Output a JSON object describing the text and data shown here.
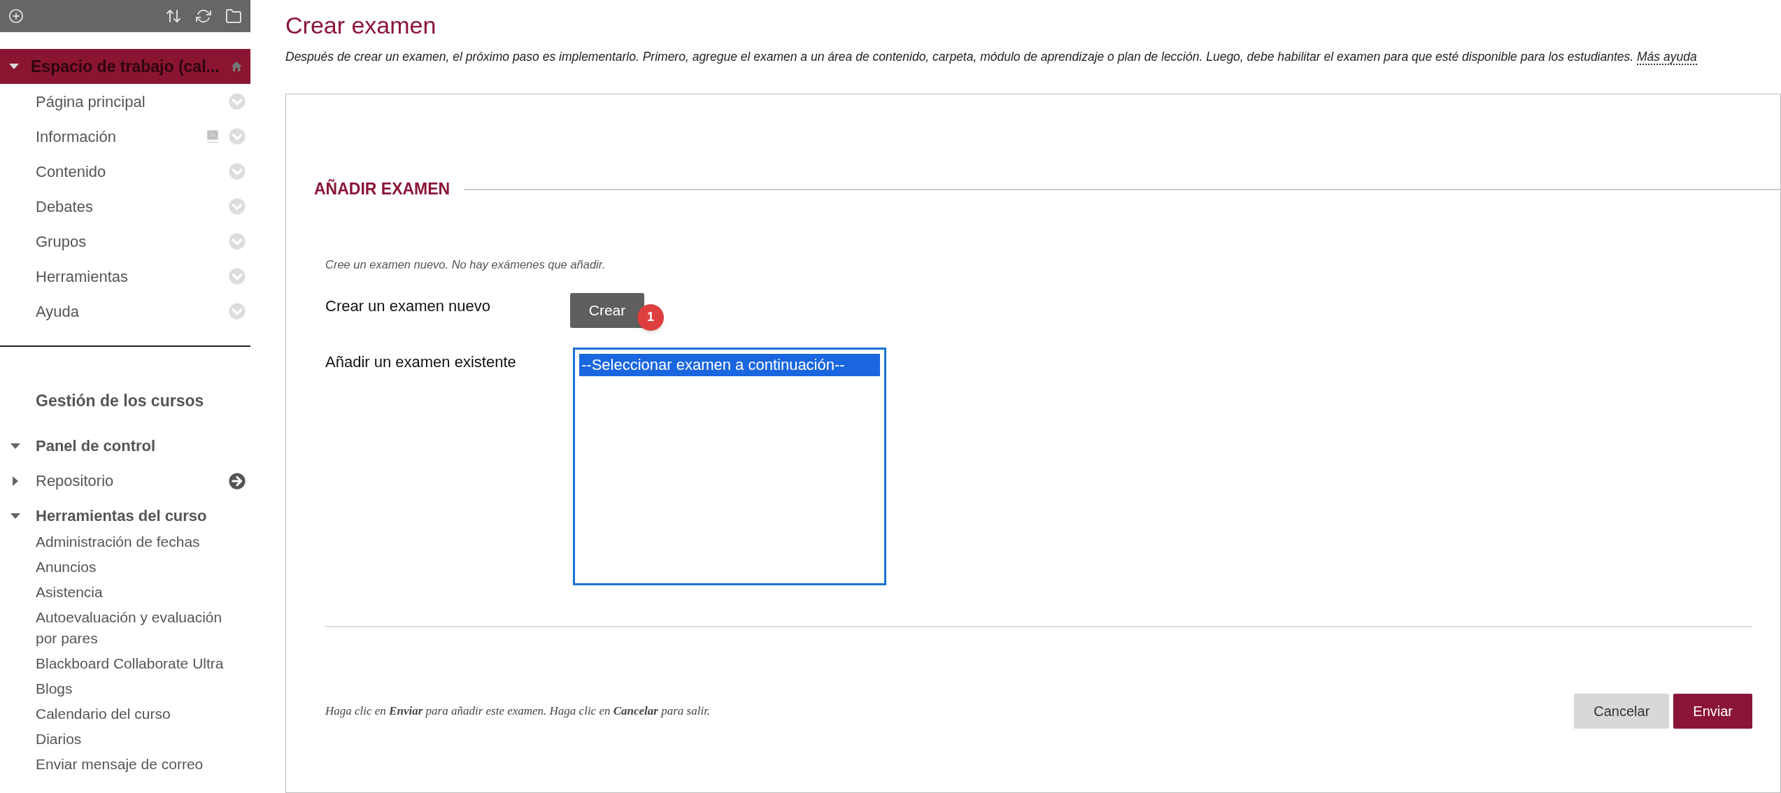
{
  "course_menu": {
    "title": "Espacio de trabajo (cal...",
    "expanded": true,
    "items": [
      {
        "label": "Página principal",
        "kind": "plain"
      },
      {
        "label": "Información",
        "kind": "flagged"
      },
      {
        "label": "Contenido",
        "kind": "plain"
      },
      {
        "label": "Debates",
        "kind": "plain"
      },
      {
        "label": "Grupos",
        "kind": "plain"
      },
      {
        "label": "Herramientas",
        "kind": "plain"
      },
      {
        "label": "Ayuda",
        "kind": "plain"
      }
    ]
  },
  "course_management": {
    "title": "Gestión de los cursos",
    "sections": [
      {
        "label": "Panel de control",
        "kind": "section",
        "expanded": true
      },
      {
        "label": "Repositorio",
        "kind": "link",
        "expanded": false
      },
      {
        "label": "Herramientas del curso",
        "kind": "section",
        "expanded": true,
        "children": [
          {
            "label": "Administración de fechas"
          },
          {
            "label": "Anuncios"
          },
          {
            "label": "Asistencia"
          },
          {
            "label": "Autoevaluación y evaluación por pares"
          },
          {
            "label": "Blackboard Collaborate Ultra"
          },
          {
            "label": "Blogs"
          },
          {
            "label": "Calendario del curso"
          },
          {
            "label": "Diarios"
          },
          {
            "label": "Enviar mensaje de correo"
          }
        ]
      }
    ]
  },
  "page": {
    "title": "Crear examen",
    "description": "Después de crear un examen, el próximo paso es implementarlo. Primero, agregue el examen a un área de contenido, carpeta, módulo de aprendizaje o plan de lección. Luego, debe habilitar el examen para que esté disponible para los estudiantes.",
    "help_link": "Más ayuda"
  },
  "section": {
    "title": "AÑADIR EXAMEN",
    "note": "Cree un examen nuevo. No hay exámenes que añadir.",
    "create_label": "Crear un examen nuevo",
    "create_button": "Crear",
    "step_badge": "1",
    "existing_label": "Añadir un examen existente",
    "options": [
      {
        "label": "--Seleccionar examen a continuación--",
        "selected": true
      }
    ]
  },
  "footer": {
    "instructions": "Haga clic en **Enviar** para añadir este examen. Haga clic en **Cancelar** para salir.",
    "buttons": [
      {
        "label": "Cancelar",
        "kind": "secondary"
      },
      {
        "label": "Enviar",
        "kind": "primary"
      }
    ]
  }
}
